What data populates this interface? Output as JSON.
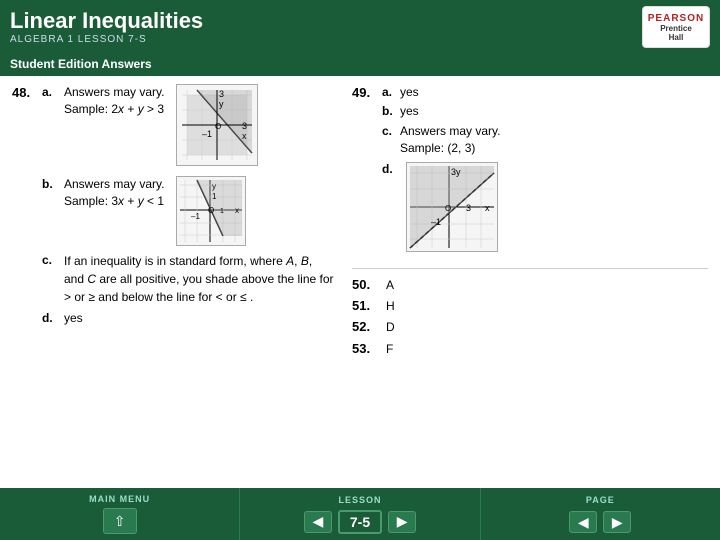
{
  "header": {
    "title": "Linear Inequalities",
    "subtitle": "ALGEBRA 1  LESSON 7-S",
    "logo_line1": "PEARSON",
    "logo_line2": "Prentice",
    "logo_line3": "Hall"
  },
  "section_bar": {
    "label": "Student Edition Answers"
  },
  "problems": {
    "p48": {
      "number": "48.",
      "part_a_label": "a.",
      "part_a_line1": "Answers may vary.",
      "part_a_line2": "Sample: 2x + y > 3",
      "part_b_label": "b.",
      "part_b_line1": "Answers may vary.",
      "part_b_line2": "Sample: 3x + y < 1",
      "part_c_label": "c.",
      "part_c_text": "If an inequality is in standard form, where A, B, and C are all positive, you shade above the line for > or ≥ and below the line for < or ≤ .",
      "part_d_label": "d.",
      "part_d_text": "yes"
    },
    "p49": {
      "number": "49.",
      "part_a_label": "a.",
      "part_a_text": "yes",
      "part_b_label": "b.",
      "part_b_text": "yes",
      "part_c_label": "c.",
      "part_c_line1": "Answers may vary.",
      "part_c_line2": "Sample: (2, 3)",
      "part_d_label": "d."
    },
    "p50": {
      "number": "50.",
      "answer": "A"
    },
    "p51": {
      "number": "51.",
      "answer": "H"
    },
    "p52": {
      "number": "52.",
      "answer": "D"
    },
    "p53": {
      "number": "53.",
      "answer": "F"
    }
  },
  "footer": {
    "main_menu_label": "MAIN MENU",
    "lesson_label": "LESSON",
    "page_label": "PAGE",
    "lesson_value": "7-5"
  }
}
